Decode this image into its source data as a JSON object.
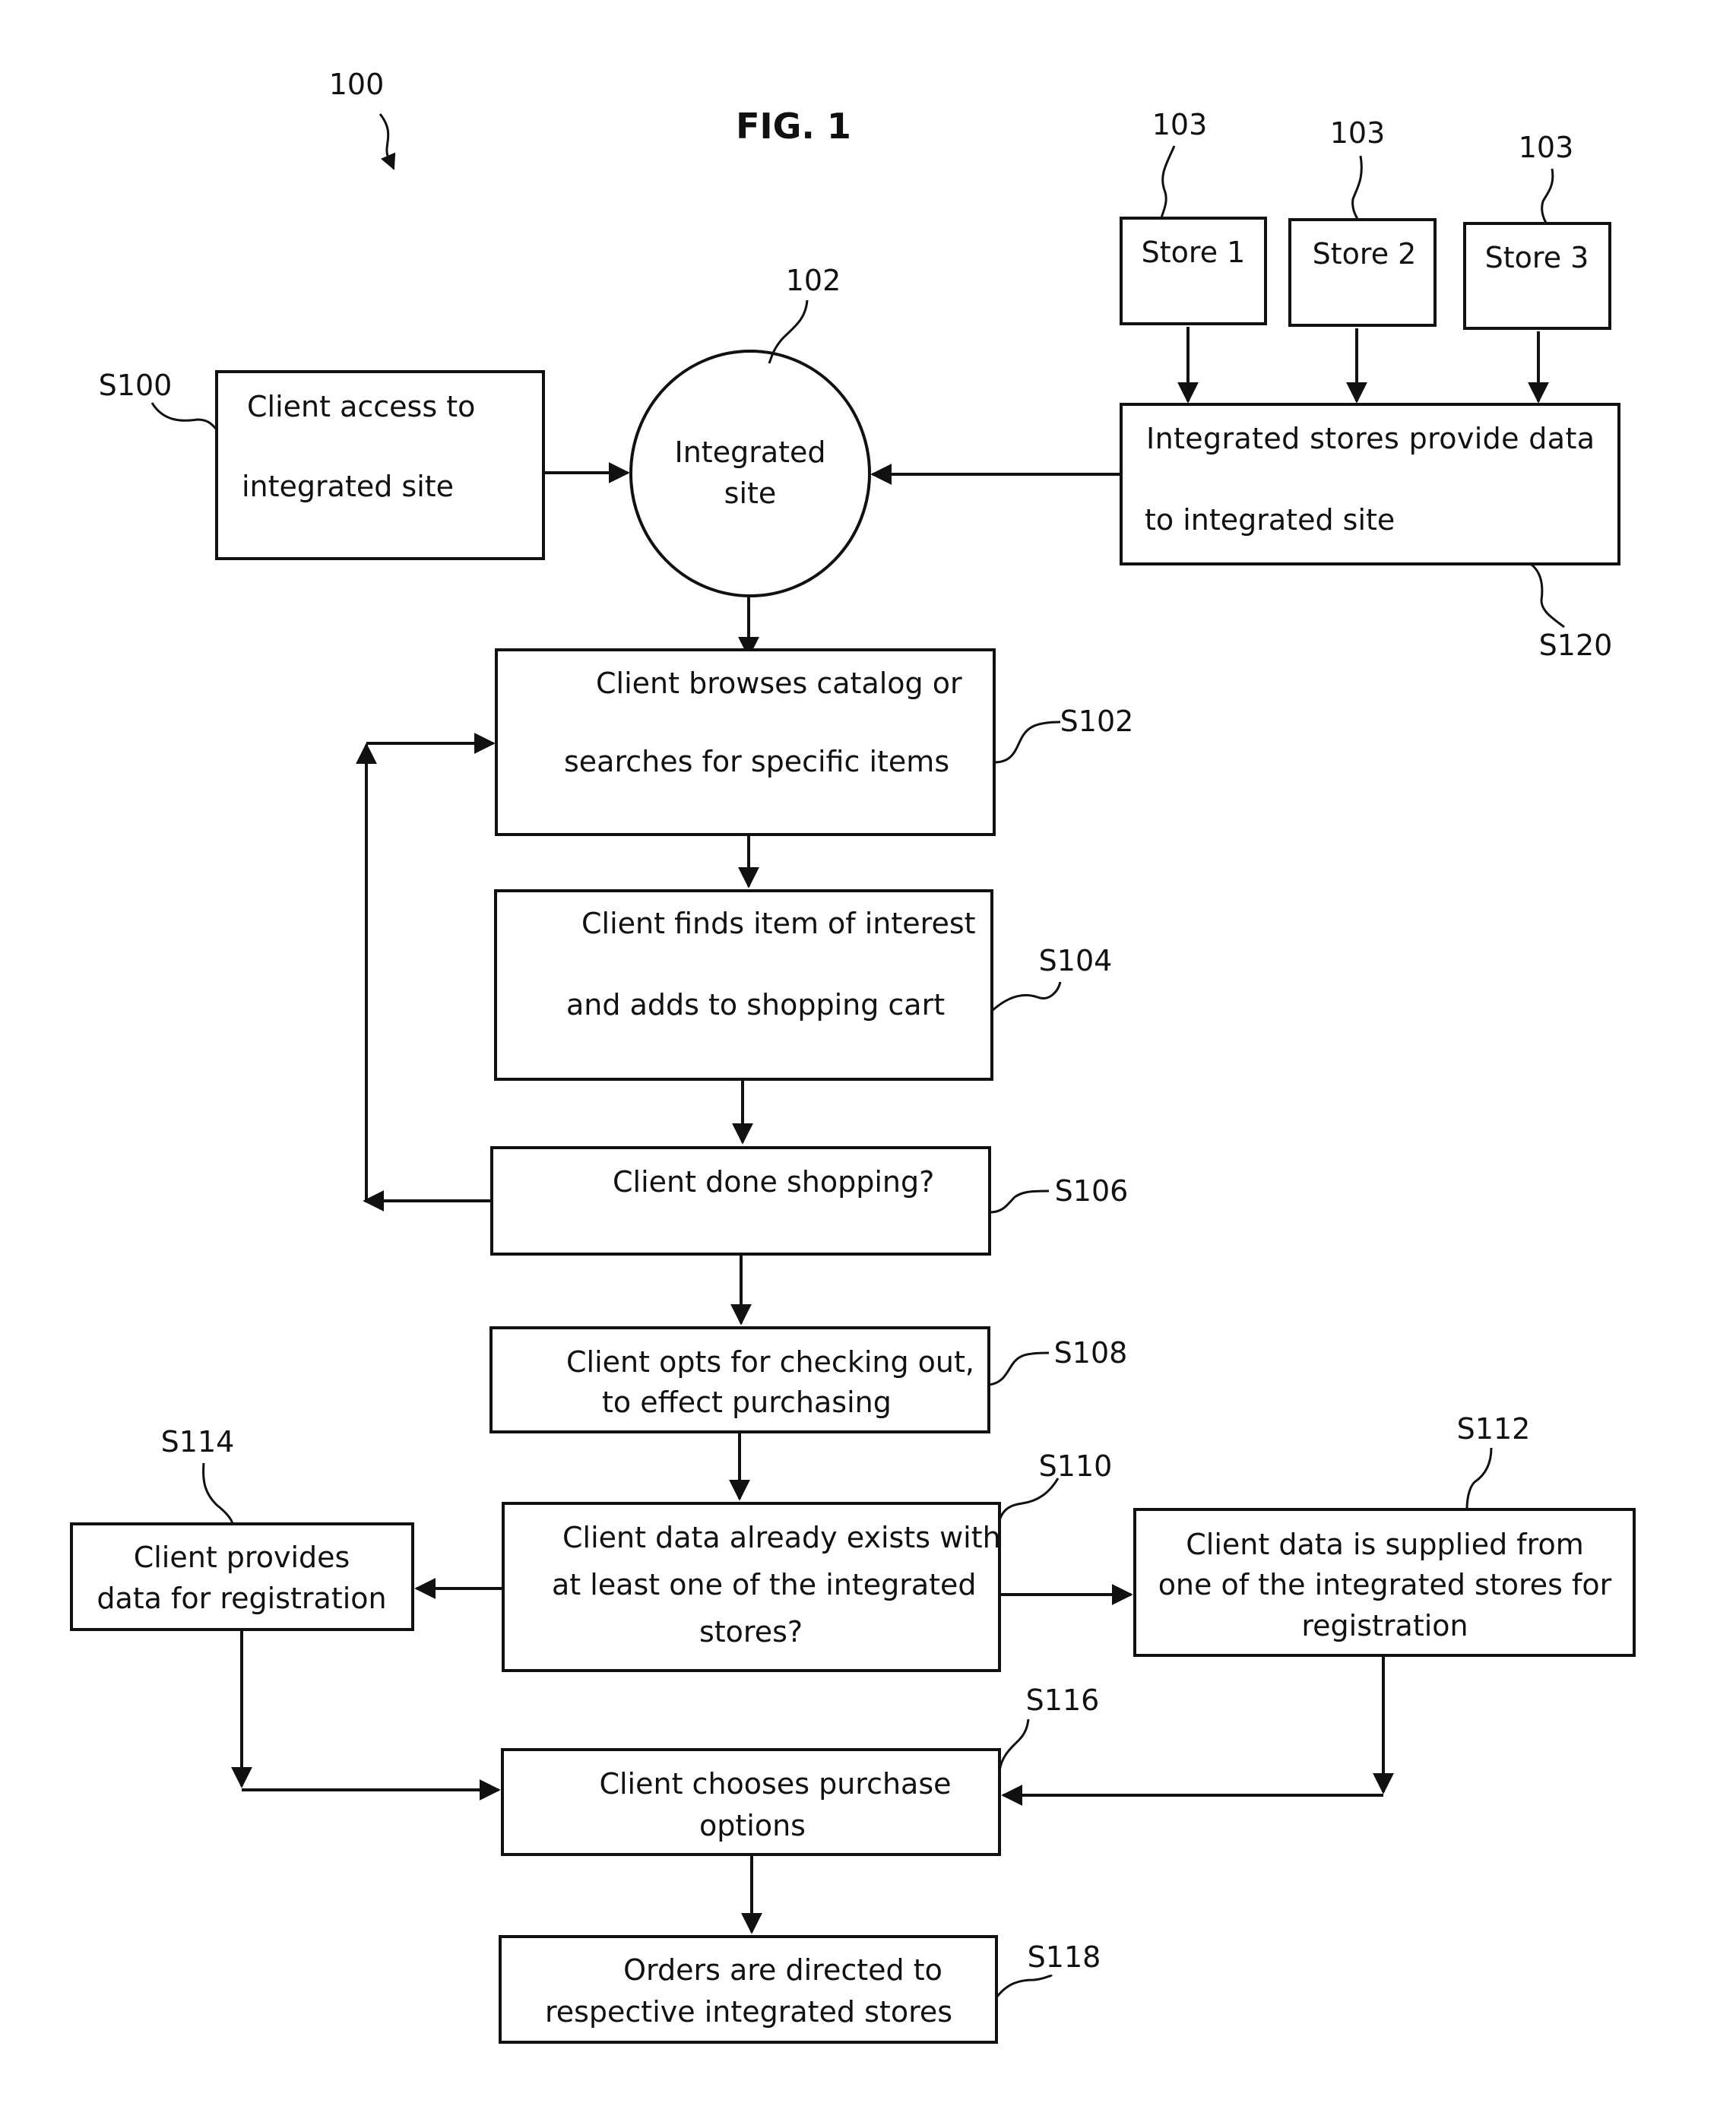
{
  "figure": {
    "title": "FIG. 1",
    "ref": "100"
  },
  "nodes": {
    "s100": {
      "id": "S100",
      "lines": [
        "Client  access  to",
        "integrated site"
      ]
    },
    "site": {
      "id": "102",
      "lines": [
        "Integrated",
        "site"
      ]
    },
    "store1": {
      "id": "103",
      "lines": [
        "Store 1"
      ]
    },
    "store2": {
      "id": "103",
      "lines": [
        "Store 2"
      ]
    },
    "store3": {
      "id": "103",
      "lines": [
        "Store 3"
      ]
    },
    "s120": {
      "id": "S120",
      "lines": [
        "Integrated  stores  provide  data",
        "to integrated site"
      ]
    },
    "s102": {
      "id": "S102",
      "lines": [
        "Client browses catalog or",
        "searches for specific items"
      ]
    },
    "s104": {
      "id": "S104",
      "lines": [
        "Client finds item of interest",
        "and adds to shopping cart"
      ]
    },
    "s106": {
      "id": "S106",
      "lines": [
        "Client done shopping?"
      ]
    },
    "s108": {
      "id": "S108",
      "lines": [
        "Client opts for checking  out,",
        "to effect purchasing"
      ]
    },
    "s110": {
      "id": "S110",
      "lines": [
        "Client data already exists with",
        "at least one of the integrated",
        "stores?"
      ]
    },
    "s114": {
      "id": "S114",
      "lines": [
        "Client provides",
        "data for registration"
      ]
    },
    "s112": {
      "id": "S112",
      "lines": [
        "Client data is supplied from",
        "one of the integrated stores for",
        "registration"
      ]
    },
    "s116": {
      "id": "S116",
      "lines": [
        "Client chooses purchase",
        "options"
      ]
    },
    "s118": {
      "id": "S118",
      "lines": [
        "Orders are directed to",
        "respective integrated stores"
      ]
    }
  },
  "edges": [
    [
      "S100",
      "102"
    ],
    [
      "103",
      "S120"
    ],
    [
      "S120",
      "102"
    ],
    [
      "102",
      "S102"
    ],
    [
      "S102",
      "S104"
    ],
    [
      "S104",
      "S106"
    ],
    [
      "S106",
      "S102"
    ],
    [
      "S106",
      "S108"
    ],
    [
      "S108",
      "S110"
    ],
    [
      "S110",
      "S114"
    ],
    [
      "S110",
      "S112"
    ],
    [
      "S114",
      "S116"
    ],
    [
      "S112",
      "S116"
    ],
    [
      "S116",
      "S118"
    ]
  ]
}
